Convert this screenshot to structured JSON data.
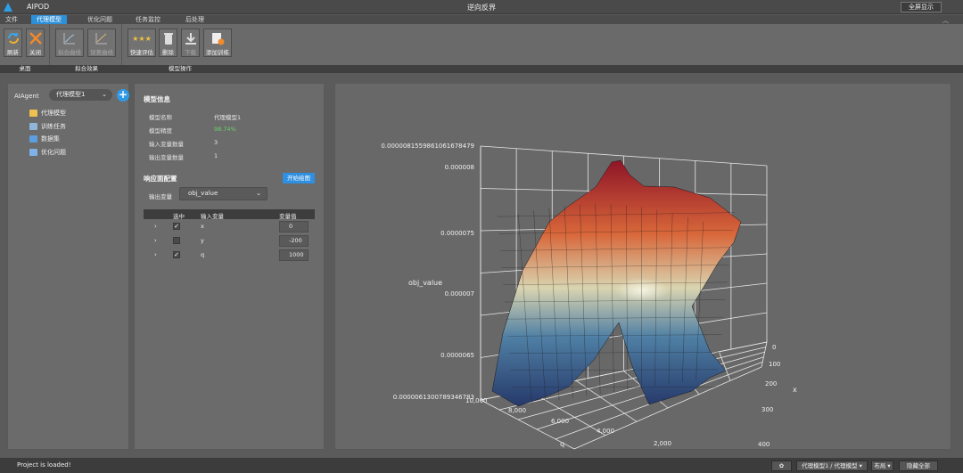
{
  "titlebar": {
    "app_name": "AIPOD",
    "window_title": "逆向反界",
    "fullscreen_label": "全屏显示"
  },
  "menu": {
    "tabs": [
      "文件",
      "代理模型",
      "优化问题",
      "任务监控",
      "后处理"
    ],
    "active_index": 1
  },
  "ribbon": {
    "buttons": {
      "refresh": "刷新",
      "close": "关闭",
      "fit_curve": "拟合曲线",
      "error_curve": "误差曲线",
      "quick_eval": "快速评估",
      "delete": "删除",
      "download": "下载",
      "add_training": "添加训练"
    },
    "groups": {
      "desktop": "桌面",
      "fit_effect": "拟合效果",
      "model_ops": "模型操作"
    }
  },
  "left_panel": {
    "agent_label": "AIAgent",
    "agent_select": "代理模型1",
    "tree": [
      {
        "label": "代理模型",
        "icon": "folder-icon"
      },
      {
        "label": "训练任务",
        "icon": "task-icon"
      },
      {
        "label": "数据集",
        "icon": "dataset-icon"
      },
      {
        "label": "优化问题",
        "icon": "optimize-icon"
      }
    ]
  },
  "model_info": {
    "title": "模型信息",
    "rows": [
      {
        "key": "模型名称",
        "value": "代理模型1"
      },
      {
        "key": "模型精度",
        "value": "98.74%"
      },
      {
        "key": "输入变量数量",
        "value": "3"
      },
      {
        "key": "输出变量数量",
        "value": "1"
      }
    ]
  },
  "response": {
    "title": "响应面配置",
    "plot_button": "开始绘图",
    "output_label": "输出变量",
    "output_value": "obj_value",
    "table_headers": [
      "选中",
      "输入变量",
      "变量值"
    ],
    "rows": [
      {
        "name": "x",
        "checked": true,
        "value": "0"
      },
      {
        "name": "y",
        "checked": false,
        "value": "-200"
      },
      {
        "name": "q",
        "checked": true,
        "value": "1000"
      }
    ]
  },
  "chart_data": {
    "type": "surface",
    "zlabel": "obj_value",
    "xlabel": "x",
    "ylabel": "q",
    "z_ticks": [
      "0.0000081559861061678479",
      "0.000008",
      "0.0000075",
      "0.000007",
      "0.0000065",
      "0.0000061300789346783"
    ],
    "x_ticks": [
      "0",
      "100",
      "200",
      "300",
      "400"
    ],
    "q_ticks": [
      "10,000",
      "8,000",
      "6,000",
      "4,000",
      "2,000"
    ],
    "z_range": [
      6.13e-06,
      8.16e-06
    ],
    "x_range": [
      0,
      400
    ],
    "q_range": [
      2000,
      10000
    ],
    "grid": true,
    "colormap": [
      "#2a3f70",
      "#4f7fa8",
      "#e6e1b8",
      "#e06a3c",
      "#9c1a2e"
    ]
  },
  "status": {
    "message": "Project is loaded!",
    "settings_icon": "gear-icon",
    "model_path": "代理模型1 / 代理模型 ▾",
    "layout": "布局 ▾",
    "hide_all": "隐藏全部"
  }
}
